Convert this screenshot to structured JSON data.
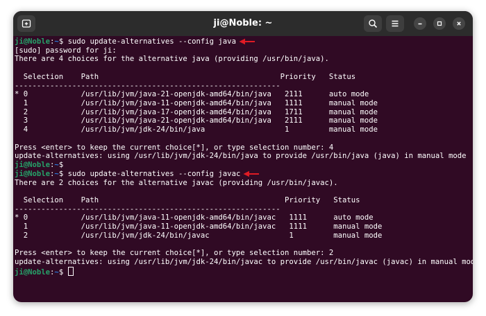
{
  "window": {
    "title": "ji@Noble: ~",
    "icons": {
      "new_tab": "new-tab-icon",
      "search": "search-icon",
      "menu": "hamburger-menu-icon",
      "minimize": "minimize-icon",
      "maximize": "maximize-icon",
      "close": "close-icon"
    }
  },
  "colors": {
    "terminal_background": "#300a24",
    "titlebar_background": "#2c2c2c",
    "prompt_user": "#26a269",
    "prompt_path": "#2a7bde",
    "arrow_annotation": "#e01b24"
  },
  "prompt": {
    "user": "ji@Noble",
    "sep": ":",
    "path": "~",
    "symbol": "$ "
  },
  "terminal": {
    "cmd1": "sudo update-alternatives --config java",
    "line_sudo": "[sudo] password for ji:",
    "java_choices": "There are 4 choices for the alternative java (providing /usr/bin/java).",
    "java_header": "  Selection    Path                                         Priority   Status",
    "java_divider": "------------------------------------------------------------",
    "java_rows": [
      "* 0            /usr/lib/jvm/java-21-openjdk-amd64/bin/java   2111      auto mode",
      "  1            /usr/lib/jvm/java-11-openjdk-amd64/bin/java   1111      manual mode",
      "  2            /usr/lib/jvm/java-17-openjdk-amd64/bin/java   1711      manual mode",
      "  3            /usr/lib/jvm/java-21-openjdk-amd64/bin/java   2111      manual mode",
      "  4            /usr/lib/jvm/jdk-24/bin/java                  1         manual mode"
    ],
    "java_press": "Press <enter> to keep the current choice[*], or type selection number: 4",
    "java_result": "update-alternatives: using /usr/lib/jvm/jdk-24/bin/java to provide /usr/bin/java (java) in manual mode",
    "cmd2": "sudo update-alternatives --config javac",
    "javac_choices": "There are 2 choices for the alternative javac (providing /usr/bin/javac).",
    "javac_header": "  Selection    Path                                          Priority   Status",
    "javac_divider": "------------------------------------------------------------",
    "javac_rows": [
      "* 0            /usr/lib/jvm/java-11-openjdk-amd64/bin/javac   1111      auto mode",
      "  1            /usr/lib/jvm/java-11-openjdk-amd64/bin/javac   1111      manual mode",
      "  2            /usr/lib/jvm/jdk-24/bin/javac                  1         manual mode"
    ],
    "javac_press": "Press <enter> to keep the current choice[*], or type selection number: 2",
    "javac_result": "update-alternatives: using /usr/lib/jvm/jdk-24/bin/javac to provide /usr/bin/javac (javac) in manual mode"
  }
}
